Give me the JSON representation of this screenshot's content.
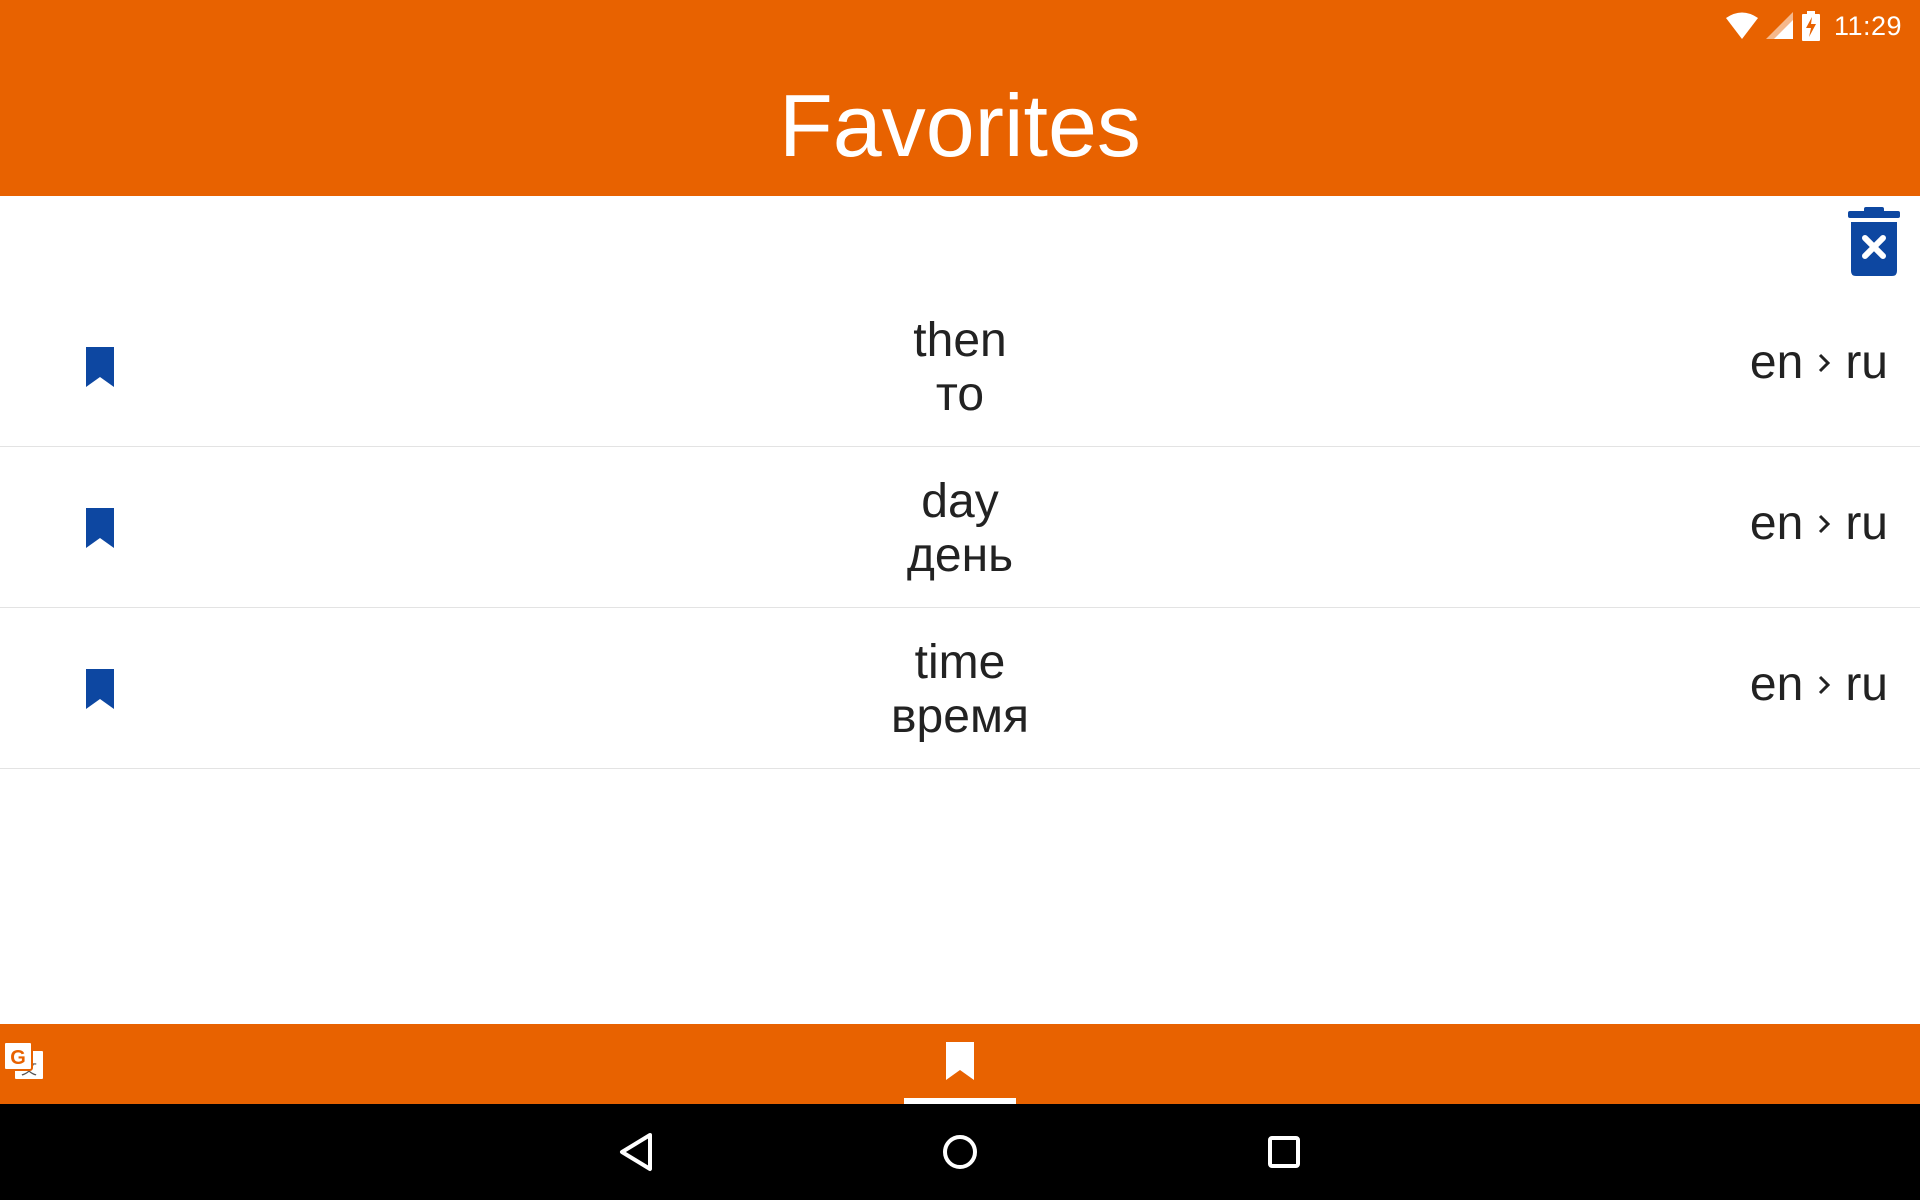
{
  "status_bar": {
    "time": "11:29",
    "icons": [
      "wifi-icon",
      "cell-signal-icon",
      "battery-charging-icon"
    ]
  },
  "header": {
    "title": "Favorites"
  },
  "toolbar": {
    "clear_icon": "delete-x-icon"
  },
  "favorites": [
    {
      "word": "then",
      "translation": "то",
      "source_lang": "en",
      "target_lang": "ru"
    },
    {
      "word": "day",
      "translation": "день",
      "source_lang": "en",
      "target_lang": "ru"
    },
    {
      "word": "time",
      "translation": "время",
      "source_lang": "en",
      "target_lang": "ru"
    }
  ],
  "bottom_tabs": [
    {
      "icon": "translate-icon",
      "selected": false
    },
    {
      "icon": "bookmark-icon",
      "selected": true
    }
  ],
  "system_nav": [
    "back-icon",
    "home-icon",
    "recents-icon"
  ],
  "colors": {
    "accent": "#e86200",
    "bookmark": "#0d47a1",
    "text": "#222222",
    "navbar": "#000000"
  }
}
